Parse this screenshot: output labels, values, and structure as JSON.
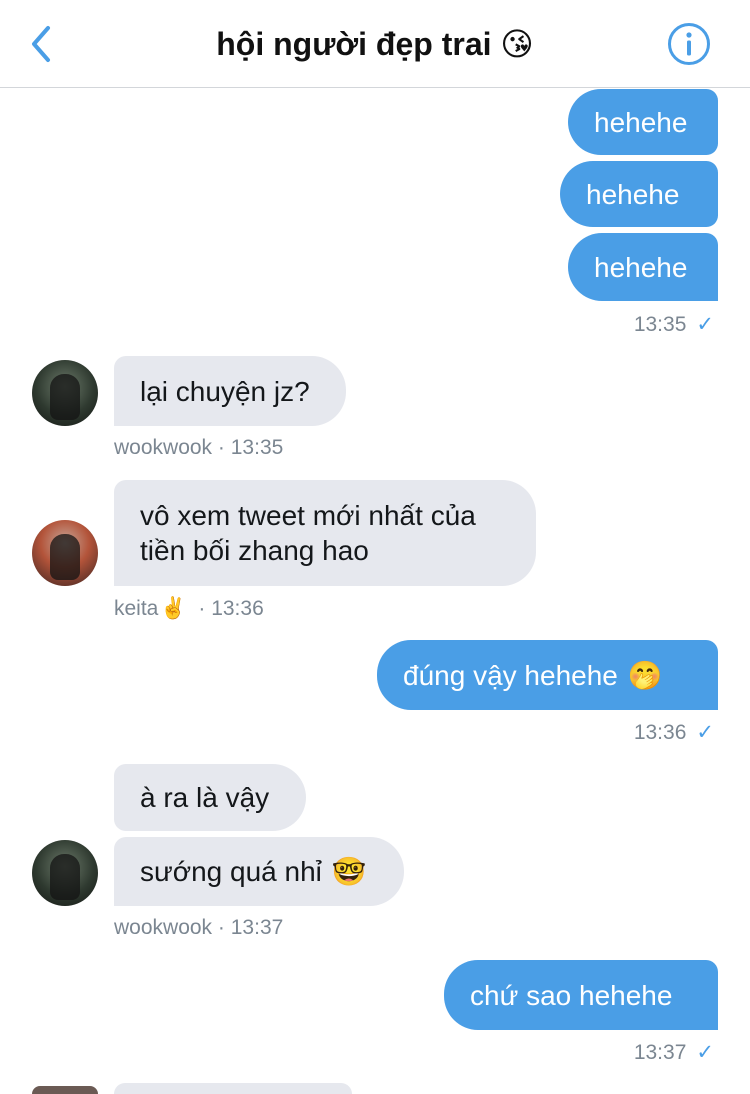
{
  "header": {
    "title": "hội người đẹp trai",
    "title_emoji": "😘",
    "back_icon": "chevron-left-icon",
    "info_icon": "info-circle-icon"
  },
  "colors": {
    "accent": "#4a9ee6",
    "received_bubble": "#e6e8ee",
    "meta_text": "#7b8691"
  },
  "messages": [
    {
      "id": "m1",
      "text": "hehehe"
    },
    {
      "id": "m2",
      "text": "hehehe"
    },
    {
      "id": "m3",
      "text": "hehehe"
    },
    {
      "id": "m4",
      "text": "lại chuyện jz?"
    },
    {
      "id": "m5",
      "text": "vô xem tweet mới nhất của tiền bối zhang hao"
    },
    {
      "id": "m6",
      "text": "đúng vậy hehehe",
      "emoji": "🤭"
    },
    {
      "id": "m7",
      "text": "à ra là vậy"
    },
    {
      "id": "m8",
      "text": "sướng quá nhỉ",
      "emoji": "🤓"
    },
    {
      "id": "m9",
      "text": "chứ sao hehehe"
    }
  ],
  "meta": {
    "t1": "13:35",
    "t2_sender": "wookwook",
    "t2_time": "13:35",
    "t3_sender": "keita",
    "t3_sender_emoji": "✌️",
    "t3_time": "13:36",
    "t4": "13:36",
    "t5_sender": "wookwook",
    "t5_time": "13:37",
    "t6": "13:37",
    "separator": "·",
    "check": "✓"
  }
}
